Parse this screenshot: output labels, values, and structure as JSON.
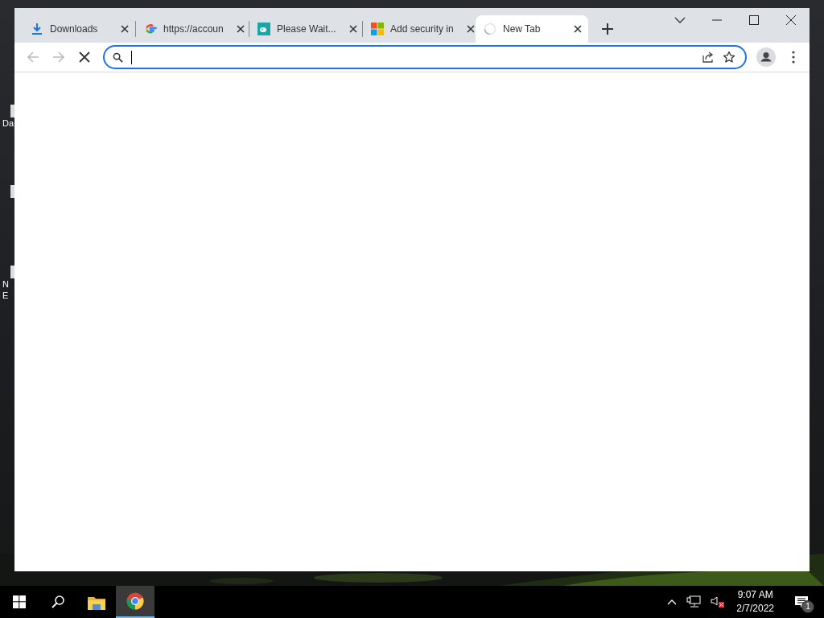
{
  "desktop_icons": [
    {
      "kind": "shortcut",
      "lines": [
        "Da"
      ]
    },
    {
      "kind": "shortcut"
    },
    {
      "kind": "shortcut",
      "lines": [
        "N",
        "E"
      ]
    }
  ],
  "window": {
    "tabs": [
      {
        "kind": "download",
        "title": "Downloads",
        "selected": false
      },
      {
        "kind": "google",
        "title": "https://accoun",
        "selected": false
      },
      {
        "kind": "teal",
        "title": "Please Wait...",
        "selected": false
      },
      {
        "kind": "windows",
        "title": "Add security in",
        "selected": false
      },
      {
        "kind": "loading",
        "title": "New Tab",
        "selected": true
      }
    ],
    "toolbar": {
      "back_disabled": true,
      "forward_disabled": true,
      "loading": true
    },
    "address_bar": {
      "focused": true
    }
  },
  "taskbar": {
    "apps": [
      {
        "kind": "start",
        "selected": false
      },
      {
        "kind": "search",
        "selected": false
      },
      {
        "kind": "folder",
        "selected": false
      },
      {
        "kind": "chrome",
        "selected": true
      }
    ],
    "time": "9:07 AM",
    "date": "2/7/2022",
    "notification_count": "1"
  }
}
